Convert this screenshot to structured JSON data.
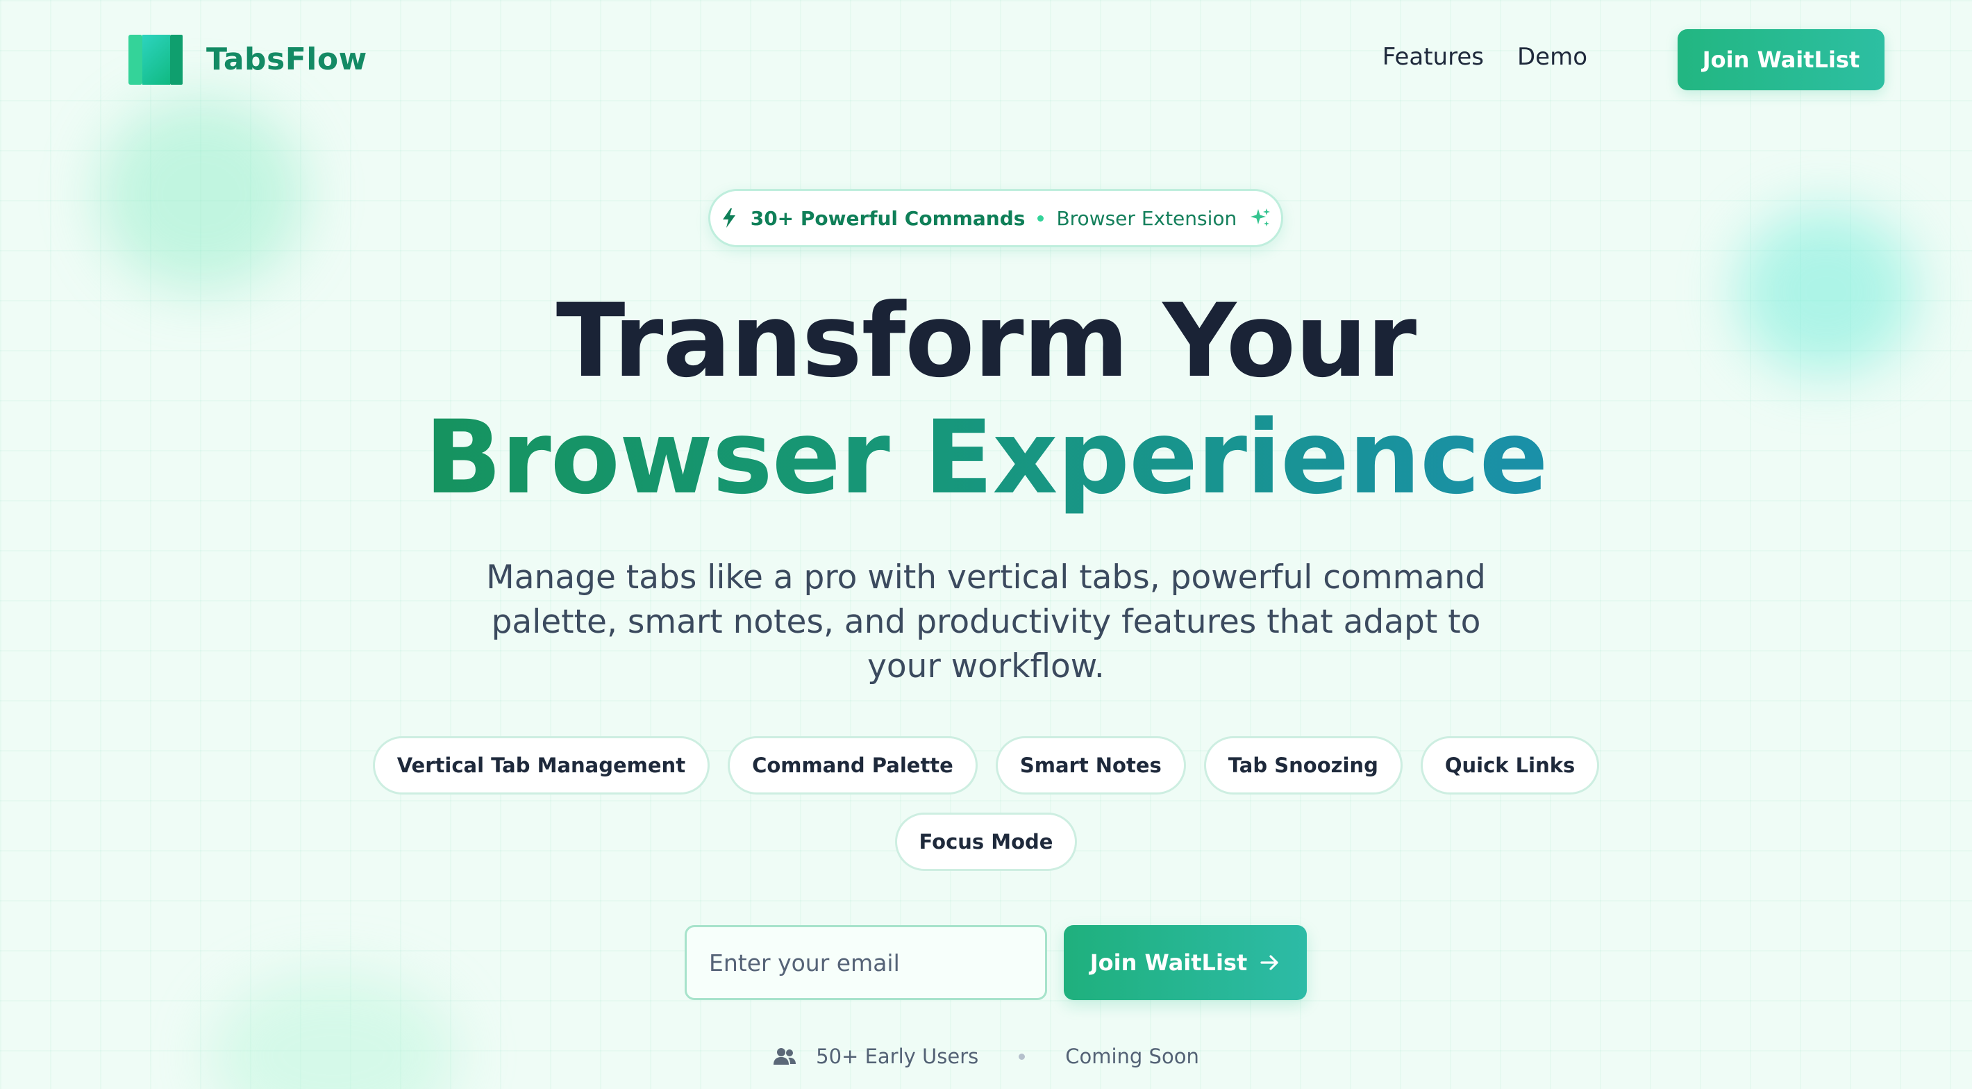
{
  "brand": {
    "name": "TabsFlow",
    "logo_icon": "tabs-logo-icon",
    "accent": "#10b981",
    "accent_dark": "#138a64",
    "background": "#effcf6"
  },
  "nav": {
    "links": [
      "Features",
      "Demo"
    ],
    "cta_label": "Join WaitList"
  },
  "hero": {
    "badge": {
      "icon": "bolt-icon",
      "strong": "30+ Powerful Commands",
      "light": "Browser Extension",
      "trailing_icon": "sparkle-icon"
    },
    "title_line1": "Transform Your",
    "title_line2": "Browser Experience",
    "subtitle": "Manage tabs like a pro with vertical tabs, powerful command palette, smart notes, and productivity features that adapt to your workflow.",
    "features": [
      "Vertical Tab Management",
      "Command Palette",
      "Smart Notes",
      "Tab Snoozing",
      "Quick Links",
      "Focus Mode"
    ]
  },
  "signup": {
    "email_placeholder": "Enter your email",
    "email_value": "",
    "button_label": "Join WaitList",
    "button_icon": "arrow-right-icon"
  },
  "meta": {
    "users_icon": "users-icon",
    "users_text": "50+ Early Users",
    "status": "Coming Soon"
  }
}
